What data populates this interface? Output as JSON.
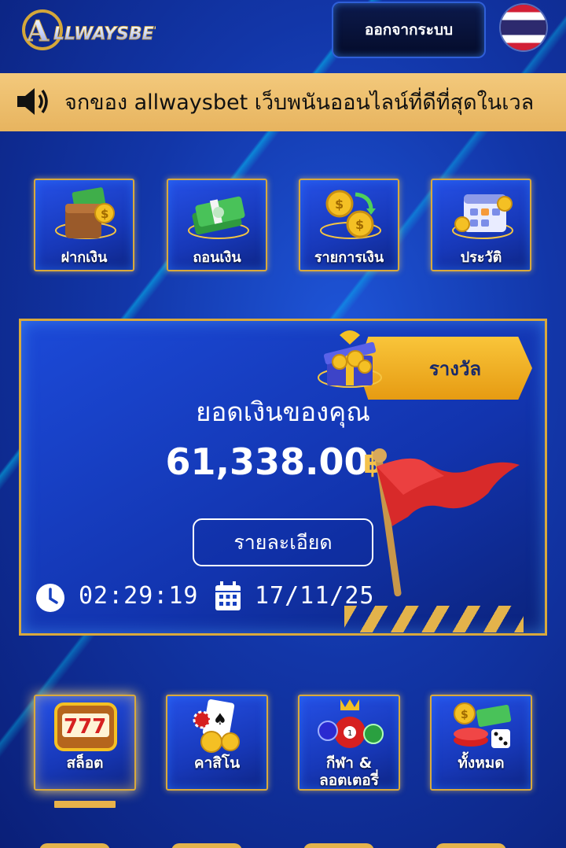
{
  "header": {
    "logo_text": "ALLWAYSBET",
    "logout_label": "ออกจากระบบ",
    "language_flag": "thailand-flag-icon"
  },
  "marquee": {
    "icon": "speaker-icon",
    "text": "จกของ allwaysbet เว็บพนันออนไลน์ที่ดีที่สุดในเวล"
  },
  "menu": {
    "items": [
      {
        "label": "ฝากเงิน",
        "icon": "wallet-money-icon"
      },
      {
        "label": "ถอนเงิน",
        "icon": "cash-stack-icon"
      },
      {
        "label": "รายการเงิน",
        "icon": "coin-exchange-icon"
      },
      {
        "label": "ประวัติ",
        "icon": "calendar-coins-icon"
      }
    ]
  },
  "balance": {
    "reward_label": "รางวัล",
    "title": "ยอดเงินของคุณ",
    "amount": "61,338.00",
    "currency_symbol": "฿",
    "details_label": "รายละเอียด",
    "time": "02:29:19",
    "date": "17/11/25"
  },
  "games": {
    "items": [
      {
        "label": "สล็อต",
        "icon": "slot-777-icon",
        "active": true
      },
      {
        "label": "คาสิโน",
        "icon": "casino-cards-icon",
        "active": false
      },
      {
        "label": "กีฬา &\nลอตเตอรี่",
        "icon": "sports-lottery-icon",
        "active": false
      },
      {
        "label": "ทั้งหมด",
        "icon": "all-games-icon",
        "active": false
      }
    ]
  },
  "colors": {
    "gold": "#d9a93c",
    "marquee_bg": "#f3c97c",
    "bg_blue": "#1236a8",
    "reward_orange": "#f0b029"
  }
}
